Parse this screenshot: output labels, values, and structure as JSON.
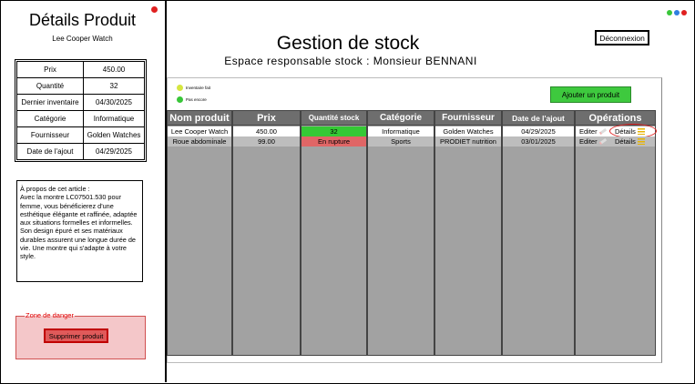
{
  "product_panel": {
    "title": "Détails Produit",
    "subtitle": "Lee Cooper Watch",
    "properties": [
      {
        "key": "Prix",
        "value": "450.00"
      },
      {
        "key": "Quantité",
        "value": "32"
      },
      {
        "key": "Dernier inventaire",
        "value": "04/30/2025"
      },
      {
        "key": "Catégorie",
        "value": "Informatique"
      },
      {
        "key": "Fournisseur",
        "value": "Golden Watches"
      },
      {
        "key": "Date de l'ajout",
        "value": "04/29/2025"
      }
    ],
    "about": "À propos de cet article :\nAvec la montre LC07501.530 pour femme, vous bénéficierez d'une esthétique élégante et raffinée, adaptée aux situations formelles et informelles. Son design épuré et ses matériaux durables assurent une longue durée de vie. Une montre qui s'adapte à votre style.",
    "danger_zone_label": "Zone de danger",
    "delete_label": "Supprimer produit"
  },
  "header": {
    "title": "Gestion de stock",
    "subtitle": "Espace responsable stock : Monsieur BENNANI",
    "logout_label": "Déconnexion"
  },
  "legend": {
    "done": "Inventaire fait",
    "not_yet": "Pas encore"
  },
  "add_button_label": "Ajouter un produit",
  "table": {
    "headers": [
      "Nom produit",
      "Prix",
      "Quantité stock",
      "Catégorie",
      "Fournisseur",
      "Date de l'ajout",
      "Opérations"
    ],
    "rows": [
      {
        "name": "Lee Cooper Watch",
        "price": "450.00",
        "stock": "32",
        "category": "Informatique",
        "supplier": "Golden Watches",
        "date": "04/29/2025",
        "edit": "Editer",
        "details": "Détails"
      },
      {
        "name": "Roue abdominale",
        "price": "99.00",
        "stock": "En rupture",
        "category": "Sports",
        "supplier": "PRODIET nutrition",
        "date": "03/01/2025",
        "edit": "Editer",
        "details": "Détails"
      }
    ]
  },
  "colors": {
    "in_stock": "#35c935",
    "out_of_stock": "#e06666",
    "column_bg": "#a2a2a2",
    "header_bg": "#6e6e6e",
    "danger_bg": "#f4c7c9",
    "add_button": "#3ec93e"
  }
}
